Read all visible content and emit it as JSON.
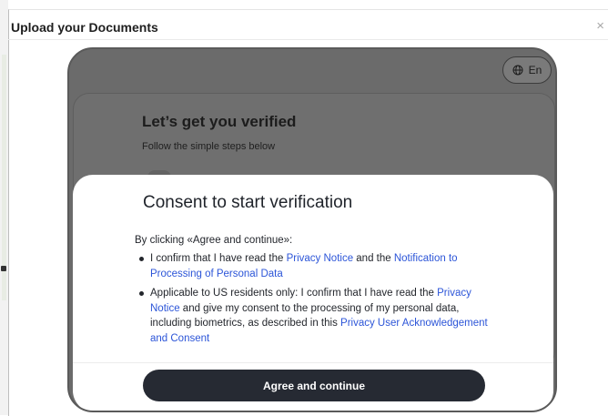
{
  "dialog": {
    "title": "Upload your Documents",
    "close_glyph": "×"
  },
  "language": {
    "label": "En",
    "icon": "globe-icon"
  },
  "background_screen": {
    "title": "Let’s get you verified",
    "subtitle": "Follow the simple steps below"
  },
  "consent": {
    "title": "Consent to start verification",
    "lead": "By clicking «Agree and continue»:",
    "item1": {
      "t1": "I confirm that I have read the ",
      "link1": "Privacy Notice",
      "t2": " and the ",
      "link2": "Notification to Processing of Personal Data"
    },
    "item2": {
      "t1": "Applicable to US residents only: I confirm that I have read the ",
      "link1": "Privacy Notice",
      "t2": " and give my consent to the processing of my personal data, including biometrics, as described in this ",
      "link2": "Privacy User Acknowledgement and Consent"
    },
    "button_label": "Agree and continue"
  },
  "colors": {
    "link": "#2c55d8",
    "primary_button": "#262a33",
    "overlay": "#6b6b6b"
  }
}
